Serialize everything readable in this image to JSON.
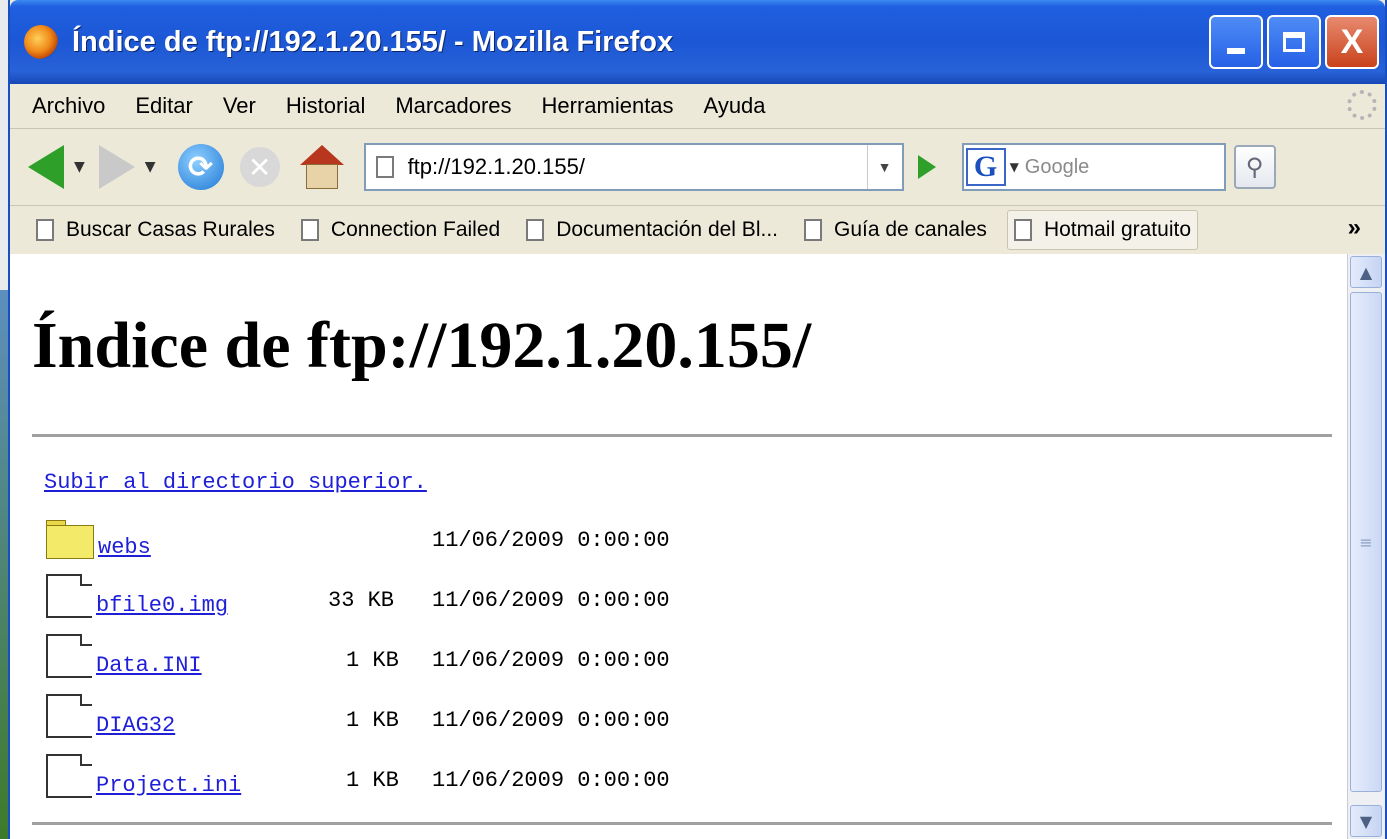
{
  "window": {
    "title": "Índice de ftp://192.1.20.155/ - Mozilla Firefox",
    "close_label": "X"
  },
  "menu": {
    "items": [
      {
        "label": "Archivo"
      },
      {
        "label": "Editar"
      },
      {
        "label": "Ver"
      },
      {
        "label": "Historial"
      },
      {
        "label": "Marcadores"
      },
      {
        "label": "Herramientas"
      },
      {
        "label": "Ayuda"
      }
    ]
  },
  "nav": {
    "url": "ftp://192.1.20.155/",
    "search_placeholder": "Google",
    "search_engine_logo": "G"
  },
  "bookmarks": {
    "items": [
      {
        "label": "Buscar Casas Rurales"
      },
      {
        "label": "Connection Failed"
      },
      {
        "label": "Documentación del Bl..."
      },
      {
        "label": "Guía de canales"
      },
      {
        "label": "Hotmail gratuito"
      }
    ],
    "overflow": "»"
  },
  "page": {
    "heading": "Índice de ftp://192.1.20.155/",
    "up_link": "Subir al directorio superior.",
    "entries": [
      {
        "name": "webs",
        "type": "folder",
        "size": "",
        "date": "11/06/2009 0:00:00"
      },
      {
        "name": "bfile0.img",
        "type": "file",
        "size": "33 KB",
        "date": "11/06/2009 0:00:00"
      },
      {
        "name": "Data.INI",
        "type": "file",
        "size": "1 KB",
        "date": "11/06/2009 0:00:00"
      },
      {
        "name": "DIAG32",
        "type": "file",
        "size": "1 KB",
        "date": "11/06/2009 0:00:00"
      },
      {
        "name": "Project.ini",
        "type": "file",
        "size": "1 KB",
        "date": "11/06/2009 0:00:00"
      }
    ]
  },
  "icons": {
    "app": "firefox-icon",
    "back": "back-arrow-icon",
    "forward": "forward-arrow-icon",
    "reload": "reload-icon",
    "stop": "stop-icon",
    "home": "home-icon",
    "go": "go-icon",
    "search": "magnifier-icon",
    "folder": "folder-icon",
    "file": "file-icon"
  },
  "colors": {
    "titlebar": "#1c57d5",
    "link": "#1f1fd8",
    "close_button": "#c9421c"
  }
}
